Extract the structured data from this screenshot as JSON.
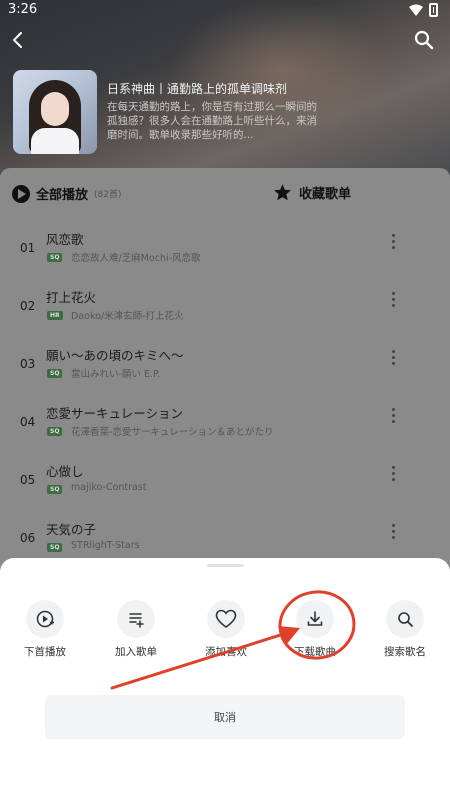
{
  "status": {
    "time": "3:26"
  },
  "playlist": {
    "title": "日系神曲丨通勤路上的孤单调味剂",
    "description": "在每天通勤的路上，你是否有过那么一瞬间的孤独感？很多人会在通勤路上听些什么，来消磨时间。歌单收录那些好听的..."
  },
  "list_header": {
    "play_all": "全部播放",
    "count": "(82首)",
    "collect": "收藏歌单"
  },
  "songs": [
    {
      "index": "01",
      "title": "风恋歌",
      "badge": "SQ",
      "subtitle": "恋恋故人难/芝麻Mochi-风恋歌"
    },
    {
      "index": "02",
      "title": "打上花火",
      "badge": "HR",
      "subtitle": "Daoko/米津玄師-打上花火"
    },
    {
      "index": "03",
      "title": "願い～あの頃のキミへ～",
      "badge": "SQ",
      "subtitle": "當山みれい-願い E.P."
    },
    {
      "index": "04",
      "title": "恋愛サーキュレーション",
      "badge": "SQ",
      "subtitle": "花澤香菜-恋愛サーキュレーション＆あとがたり"
    },
    {
      "index": "05",
      "title": "心做し",
      "badge": "SQ",
      "subtitle": "majiko-Contrast"
    },
    {
      "index": "06",
      "title": "天気の子",
      "badge": "SQ",
      "subtitle": "STRlighT-Stars"
    }
  ],
  "sheet": {
    "actions": [
      {
        "label": "下首播放",
        "icon": "play-next-icon"
      },
      {
        "label": "加入歌单",
        "icon": "add-to-playlist-icon"
      },
      {
        "label": "添加喜欢",
        "icon": "heart-icon"
      },
      {
        "label": "下载歌曲",
        "icon": "download-icon"
      },
      {
        "label": "搜索歌名",
        "icon": "search-icon"
      }
    ],
    "cancel": "取消"
  },
  "colors": {
    "sheet_bg": "#ffffff",
    "annotation_red": "#e0402a",
    "dim_bg": "#8a8a8a"
  }
}
